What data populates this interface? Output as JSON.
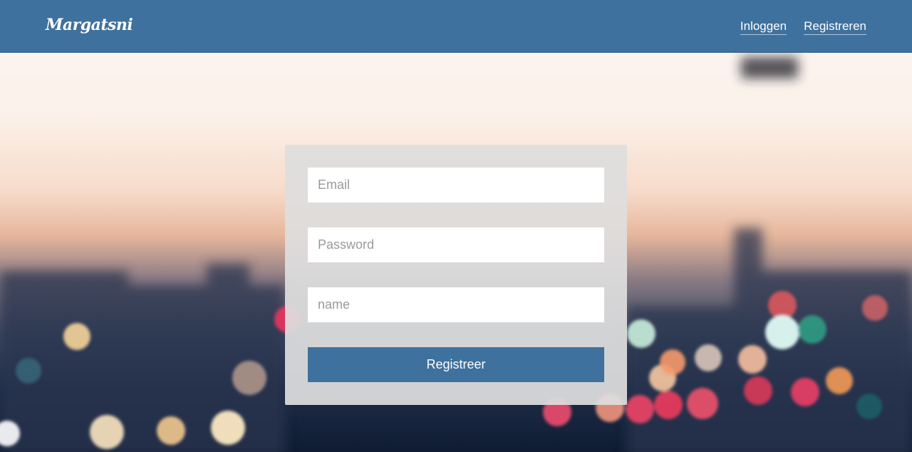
{
  "navbar": {
    "brand": "Margatsni",
    "links": [
      "Inloggen",
      "Registreren"
    ],
    "color": "#3e719d"
  },
  "form": {
    "email_placeholder": "Email",
    "password_placeholder": "Password",
    "name_placeholder": "name",
    "submit_label": "Registreer"
  }
}
